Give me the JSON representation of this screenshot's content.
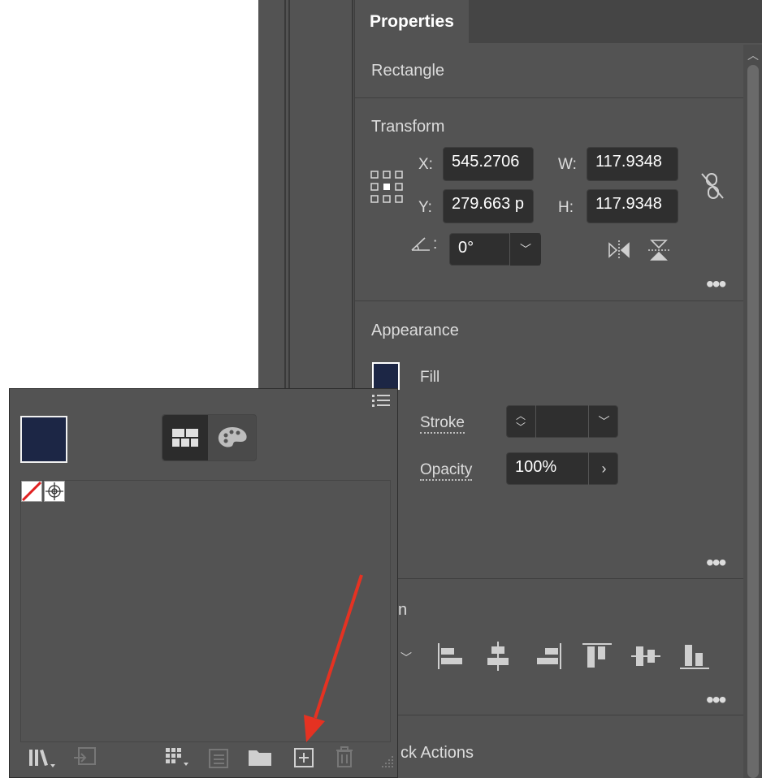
{
  "properties_panel": {
    "tab_label": "Properties",
    "object_type": "Rectangle",
    "transform": {
      "title": "Transform",
      "x_label": "X:",
      "x_value": "545.2706",
      "y_label": "Y:",
      "y_value": "279.663 p",
      "w_label": "W:",
      "w_value": "117.9348",
      "h_label": "H:",
      "h_value": "117.9348",
      "angle_value": "0°",
      "angle_label": ":"
    },
    "appearance": {
      "title": "Appearance",
      "fill_label": "Fill",
      "fill_color": "#1c2645",
      "stroke_label": "Stroke",
      "opacity_label": "Opacity",
      "opacity_value": "100%"
    },
    "align": {
      "title_partial": "n"
    },
    "quick_actions": {
      "title_partial": "ck Actions"
    },
    "more_label": "•••"
  },
  "swatches_panel": {
    "current_fill_color": "#1c2645",
    "bottom_icons": [
      "libraries-icon",
      "place-icon",
      "swatch-kind-icon",
      "swatch-options-icon",
      "folder-icon",
      "new-swatch-icon",
      "delete-icon"
    ]
  },
  "annotation": {
    "arrow_color": "#e53222"
  }
}
